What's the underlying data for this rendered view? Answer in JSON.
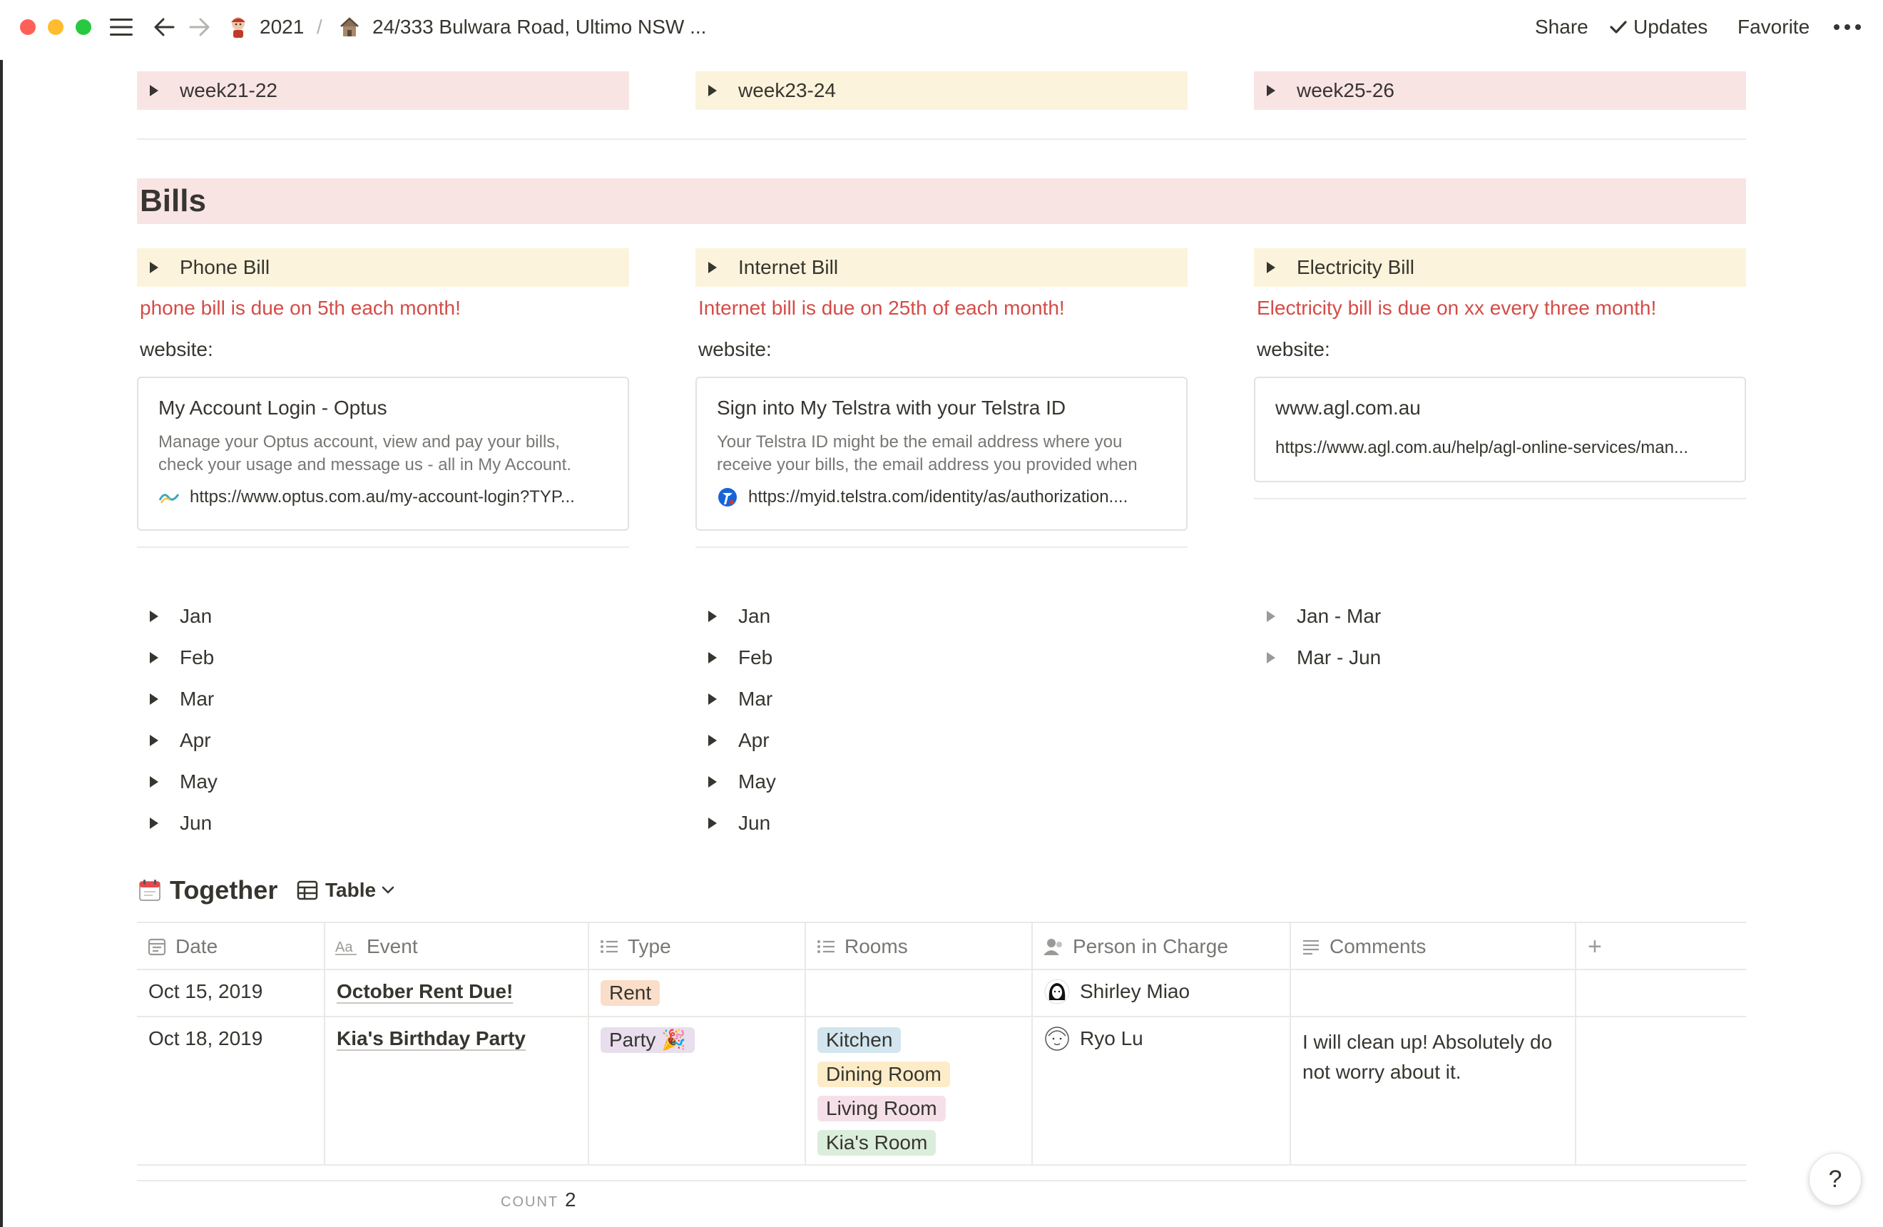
{
  "topbar": {
    "breadcrumb_1": "2021",
    "separator": "/",
    "breadcrumb_2": "24/333 Bulwara Road, Ultimo NSW ...",
    "share": "Share",
    "updates": "Updates",
    "favorite": "Favorite"
  },
  "weeks": [
    "week21-22",
    "week23-24",
    "week25-26"
  ],
  "bills": {
    "heading": "Bills",
    "columns": [
      {
        "toggle": "Phone Bill",
        "note": "phone bill is due on 5th each month!",
        "website_label": "website:",
        "bookmark": {
          "title": "My Account Login - Optus",
          "description": "Manage your Optus account, view and pay your bills, check your usage and message us - all in My Account.",
          "url": "https://www.optus.com.au/my-account-login?TYP..."
        },
        "months": [
          "Jan",
          "Feb",
          "Mar",
          "Apr",
          "May",
          "Jun"
        ]
      },
      {
        "toggle": "Internet Bill",
        "note": "Internet bill is due on 25th of each month!",
        "website_label": "website:",
        "bookmark": {
          "title": "Sign into My Telstra with your Telstra ID",
          "description": "Your Telstra ID might be the email address where you receive your bills, the email address you provided when",
          "url": "https://myid.telstra.com/identity/as/authorization...."
        },
        "months": [
          "Jan",
          "Feb",
          "Mar",
          "Apr",
          "May",
          "Jun"
        ]
      },
      {
        "toggle": "Electricity Bill",
        "note": "Electricity bill is due on xx every three month!",
        "website_label": "website:",
        "bookmark": {
          "title": "www.agl.com.au",
          "url": "https://www.agl.com.au/help/agl-online-services/man..."
        },
        "months": [
          "Jan - Mar",
          "Mar - Jun"
        ]
      }
    ]
  },
  "database": {
    "title": "Together",
    "view": "Table",
    "columns": [
      "Date",
      "Event",
      "Type",
      "Rooms",
      "Person in Charge",
      "Comments"
    ],
    "add_column": "+",
    "rows": [
      {
        "date": "Oct 15, 2019",
        "event": "October Rent Due!",
        "type": "Rent",
        "rooms": [],
        "person": "Shirley Miao",
        "comments": ""
      },
      {
        "date": "Oct 18, 2019",
        "event": "Kia's Birthday Party",
        "type": "Party 🎉",
        "rooms": [
          "Kitchen",
          "Dining Room",
          "Living Room",
          "Kia's Room"
        ],
        "person": "Ryo Lu",
        "comments_line1": "I will clean up! Absolutely do",
        "comments_line2": "not worry about it."
      }
    ],
    "count_label": "COUNT",
    "count_value": "2"
  },
  "colors": {
    "pink_block": "#f9e4e4",
    "yellow_block": "#fbf3db",
    "red_text": "#d44c47",
    "tag_rent": "#fadec9",
    "tag_party": "#e8deee",
    "tag_kitchen": "#d3e5ef",
    "tag_dining": "#fdecc8",
    "tag_living": "#f5e0e9",
    "tag_kias_room": "#dbeddb"
  },
  "icons": {
    "help": "?"
  }
}
